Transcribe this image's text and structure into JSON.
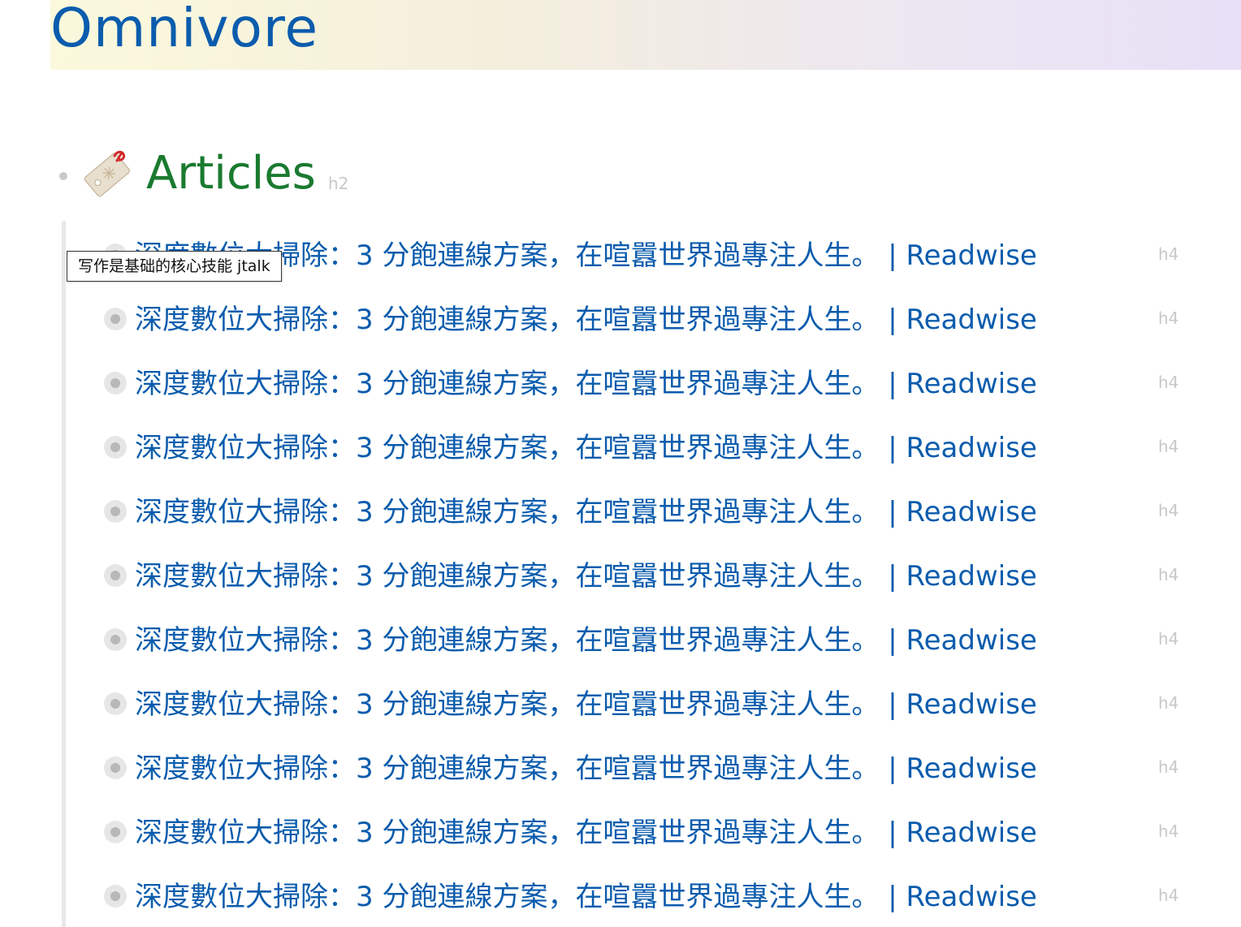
{
  "page": {
    "title": "Omnivore"
  },
  "section": {
    "heading": "Articles",
    "heading_level": "h2",
    "icon": "tag-icon"
  },
  "tooltip": {
    "text": "写作是基础的核心技能 jtalk"
  },
  "articles": [
    {
      "title": "深度數位大掃除：3 分飽連線方案，在喧囂世界過專注人生。 | Readwise",
      "level": "h4"
    },
    {
      "title": "深度數位大掃除：3 分飽連線方案，在喧囂世界過專注人生。 | Readwise",
      "level": "h4"
    },
    {
      "title": "深度數位大掃除：3 分飽連線方案，在喧囂世界過專注人生。 | Readwise",
      "level": "h4"
    },
    {
      "title": "深度數位大掃除：3 分飽連線方案，在喧囂世界過專注人生。 | Readwise",
      "level": "h4"
    },
    {
      "title": "深度數位大掃除：3 分飽連線方案，在喧囂世界過專注人生。 | Readwise",
      "level": "h4"
    },
    {
      "title": "深度數位大掃除：3 分飽連線方案，在喧囂世界過專注人生。 | Readwise",
      "level": "h4"
    },
    {
      "title": "深度數位大掃除：3 分飽連線方案，在喧囂世界過專注人生。 | Readwise",
      "level": "h4"
    },
    {
      "title": "深度數位大掃除：3 分飽連線方案，在喧囂世界過專注人生。 | Readwise",
      "level": "h4"
    },
    {
      "title": "深度數位大掃除：3 分飽連線方案，在喧囂世界過專注人生。 | Readwise",
      "level": "h4"
    },
    {
      "title": "深度數位大掃除：3 分飽連線方案，在喧囂世界過專注人生。 | Readwise",
      "level": "h4"
    },
    {
      "title": "深度數位大掃除：3 分飽連線方案，在喧囂世界過專注人生。 | Readwise",
      "level": "h4"
    }
  ],
  "colors": {
    "link": "#0b5cad",
    "heading_green": "#1a7a2f",
    "marker_gray": "#c8c8c8"
  }
}
